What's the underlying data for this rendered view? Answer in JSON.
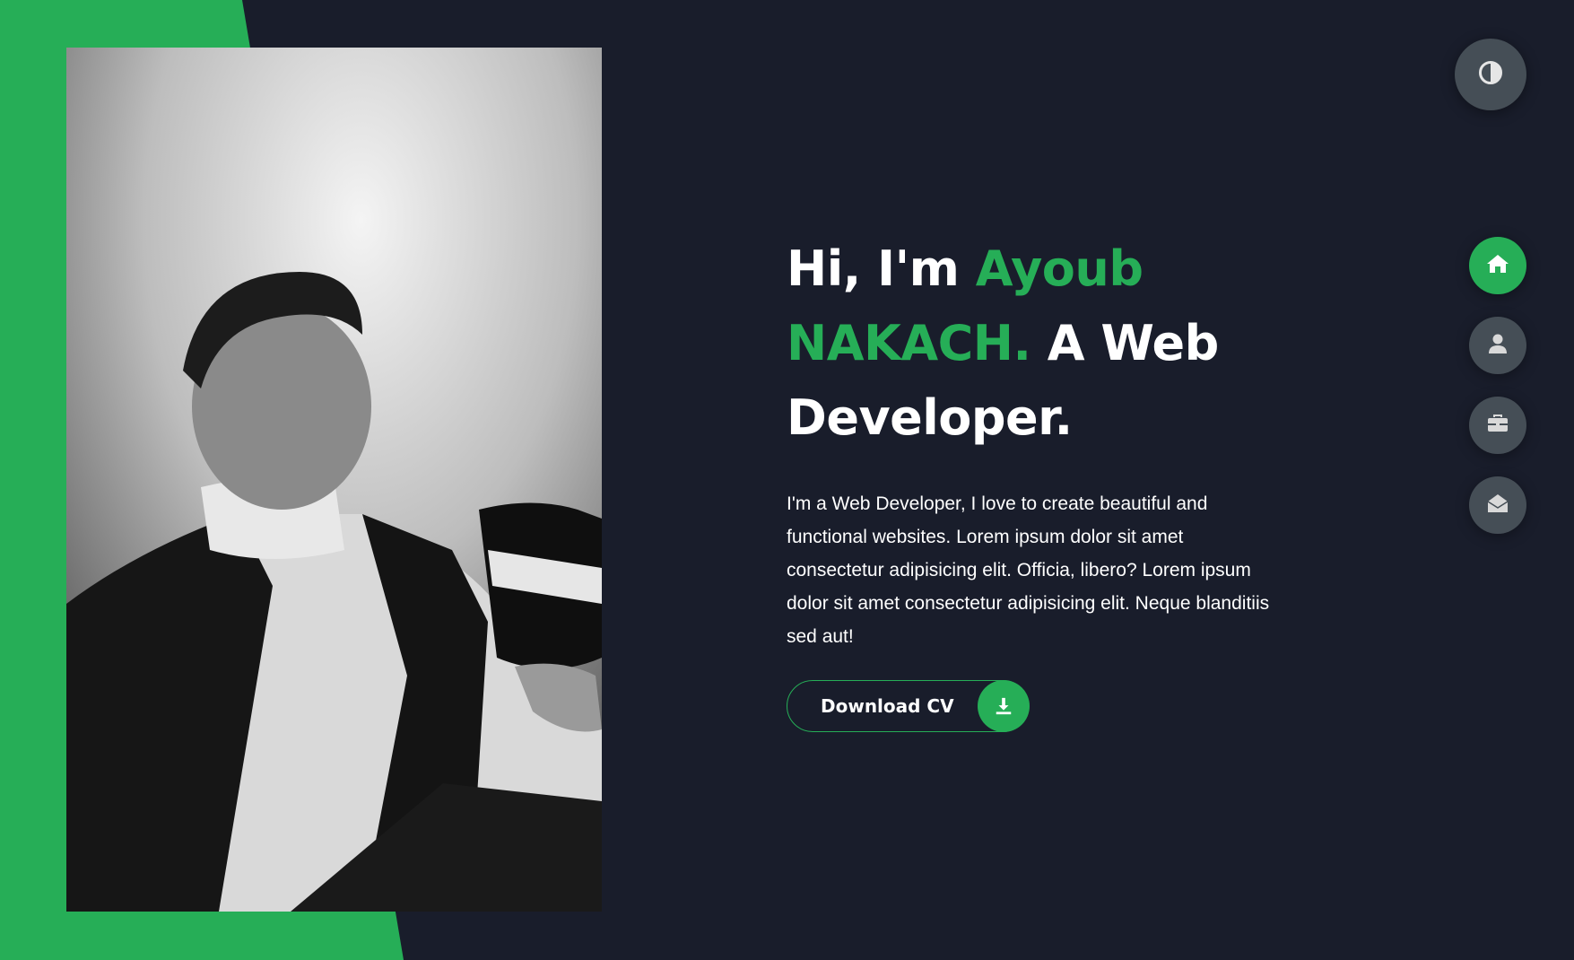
{
  "hero": {
    "title_part1": "Hi, I'm ",
    "title_name": "Ayoub NAKACH.",
    "title_part2": " A Web Developer.",
    "description": "I'm a Web Developer, I love to create beautiful and functional websites. Lorem ipsum dolor sit amet consectetur adipisicing elit. Officia, libero? Lorem ipsum dolor sit amet consectetur adipisicing elit. Neque blanditiis sed aut!",
    "cv_button_label": "Download CV",
    "cv_button_icon": "download-icon"
  },
  "theme_toggle": {
    "icon": "contrast-icon"
  },
  "side_nav": {
    "items": [
      {
        "icon": "home-icon",
        "active": true
      },
      {
        "icon": "user-icon",
        "active": false
      },
      {
        "icon": "briefcase-icon",
        "active": false
      },
      {
        "icon": "envelope-open-icon",
        "active": false
      }
    ]
  },
  "colors": {
    "accent": "#26ae57",
    "background": "#191d2b",
    "button_grey": "#454e56",
    "text": "#ffffff"
  }
}
